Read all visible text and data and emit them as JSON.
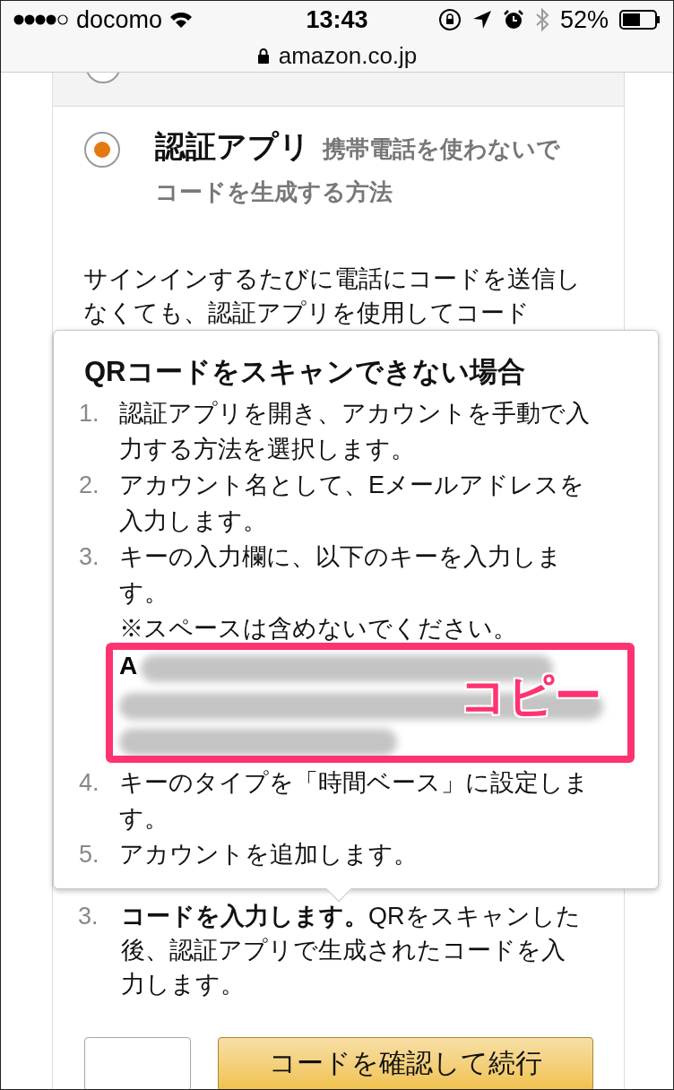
{
  "status_bar": {
    "carrier": "docomo",
    "time": "13:43",
    "battery": "52%"
  },
  "address_bar": {
    "url": "amazon.co.jp"
  },
  "options": [
    {
      "kind": "cut",
      "selected": false
    },
    {
      "kind": "full",
      "title": "認証アプリ",
      "description": "携帯電話を使わないでコードを生成する方法",
      "selected": true
    }
  ],
  "intro": "サインインするたびに電話にコードを送信しなくても、認証アプリを使用してコード",
  "popover": {
    "title": "QRコードをスキャンできない場合",
    "steps": [
      {
        "number": "1.",
        "text": "認証アプリを開き、アカウントを手動で入力する方法を選択します。"
      },
      {
        "number": "2.",
        "text": "アカウント名として、Eメールアドレスを入力します。"
      },
      {
        "number": "3.",
        "text": "キーの入力欄に、以下のキーを入力します。",
        "note": "※スペースは含めないでください。",
        "key_prefix": "A"
      },
      {
        "number": "4.",
        "text": "キーのタイプを「時間ベース」に設定します。"
      },
      {
        "number": "5.",
        "text": "アカウントを追加します。"
      }
    ],
    "annotation": "コピー"
  },
  "steps": [
    {
      "number": "3.",
      "text": "**コードを入力します。**QRをスキャンした後、認証アプリで生成されたコードを入力します。"
    }
  ],
  "verify_button": "コードを確認して続行"
}
